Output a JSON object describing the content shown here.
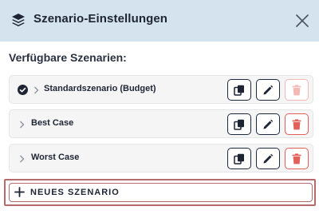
{
  "dialog": {
    "title": "Szenario-Einstellungen",
    "icon": "layers-icon",
    "close_icon": "close-icon"
  },
  "section_label": "Verfügbare Szenarien:",
  "scenarios": [
    {
      "name": "Standardszenario (Budget)",
      "active": true,
      "delete_enabled": false
    },
    {
      "name": "Best Case",
      "active": false,
      "delete_enabled": true
    },
    {
      "name": "Worst Case",
      "active": false,
      "delete_enabled": true
    }
  ],
  "actions": {
    "copy_icon": "copy-icon",
    "edit_icon": "pencil-icon",
    "delete_icon": "trash-icon"
  },
  "new_scenario": {
    "label": "NEUES SZENARIO",
    "icon": "plus-icon"
  },
  "colors": {
    "header_bg": "#d5e3ee",
    "row_bg": "#f5f5f6",
    "button_border": "#1d2a3d",
    "delete_red": "#e0605a",
    "delete_disabled": "#f2b9b5",
    "highlight_border": "#b56b6b"
  }
}
